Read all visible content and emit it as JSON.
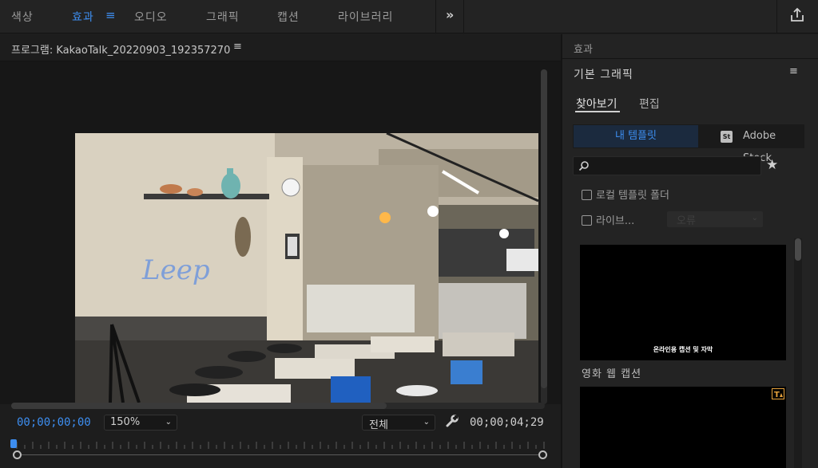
{
  "topbar": {
    "tabs": [
      "색상",
      "효과",
      "오디오",
      "그래픽",
      "캡션",
      "라이브러리"
    ],
    "active_tab_index": 1,
    "accent_color": "#3d8ef0"
  },
  "program": {
    "title": "프로그램: KakaoTalk_20220903_192357270",
    "current_timecode": "00;00;00;00",
    "duration_timecode": "00;00;04;29",
    "zoom": "150%",
    "quality": "전체"
  },
  "effects_panel": {
    "title": "효과",
    "essential_graphics": {
      "title": "기본 그래픽",
      "tabs": [
        "찾아보기",
        "편집"
      ],
      "toggle_mine": "내 템플릿",
      "toggle_stock": "Adobe Stock",
      "stock_badge": "St",
      "search_placeholder": "",
      "local_folder_label": "로컬 템플릿 폴더",
      "libraries_label": "라이브...",
      "libraries_dropdown": "오류",
      "templates": [
        {
          "thumb_caption": "온라인용 캡션 및 자막",
          "name": "영화 웹 캡션"
        },
        {
          "thumb_caption": "",
          "name": ""
        }
      ]
    }
  }
}
